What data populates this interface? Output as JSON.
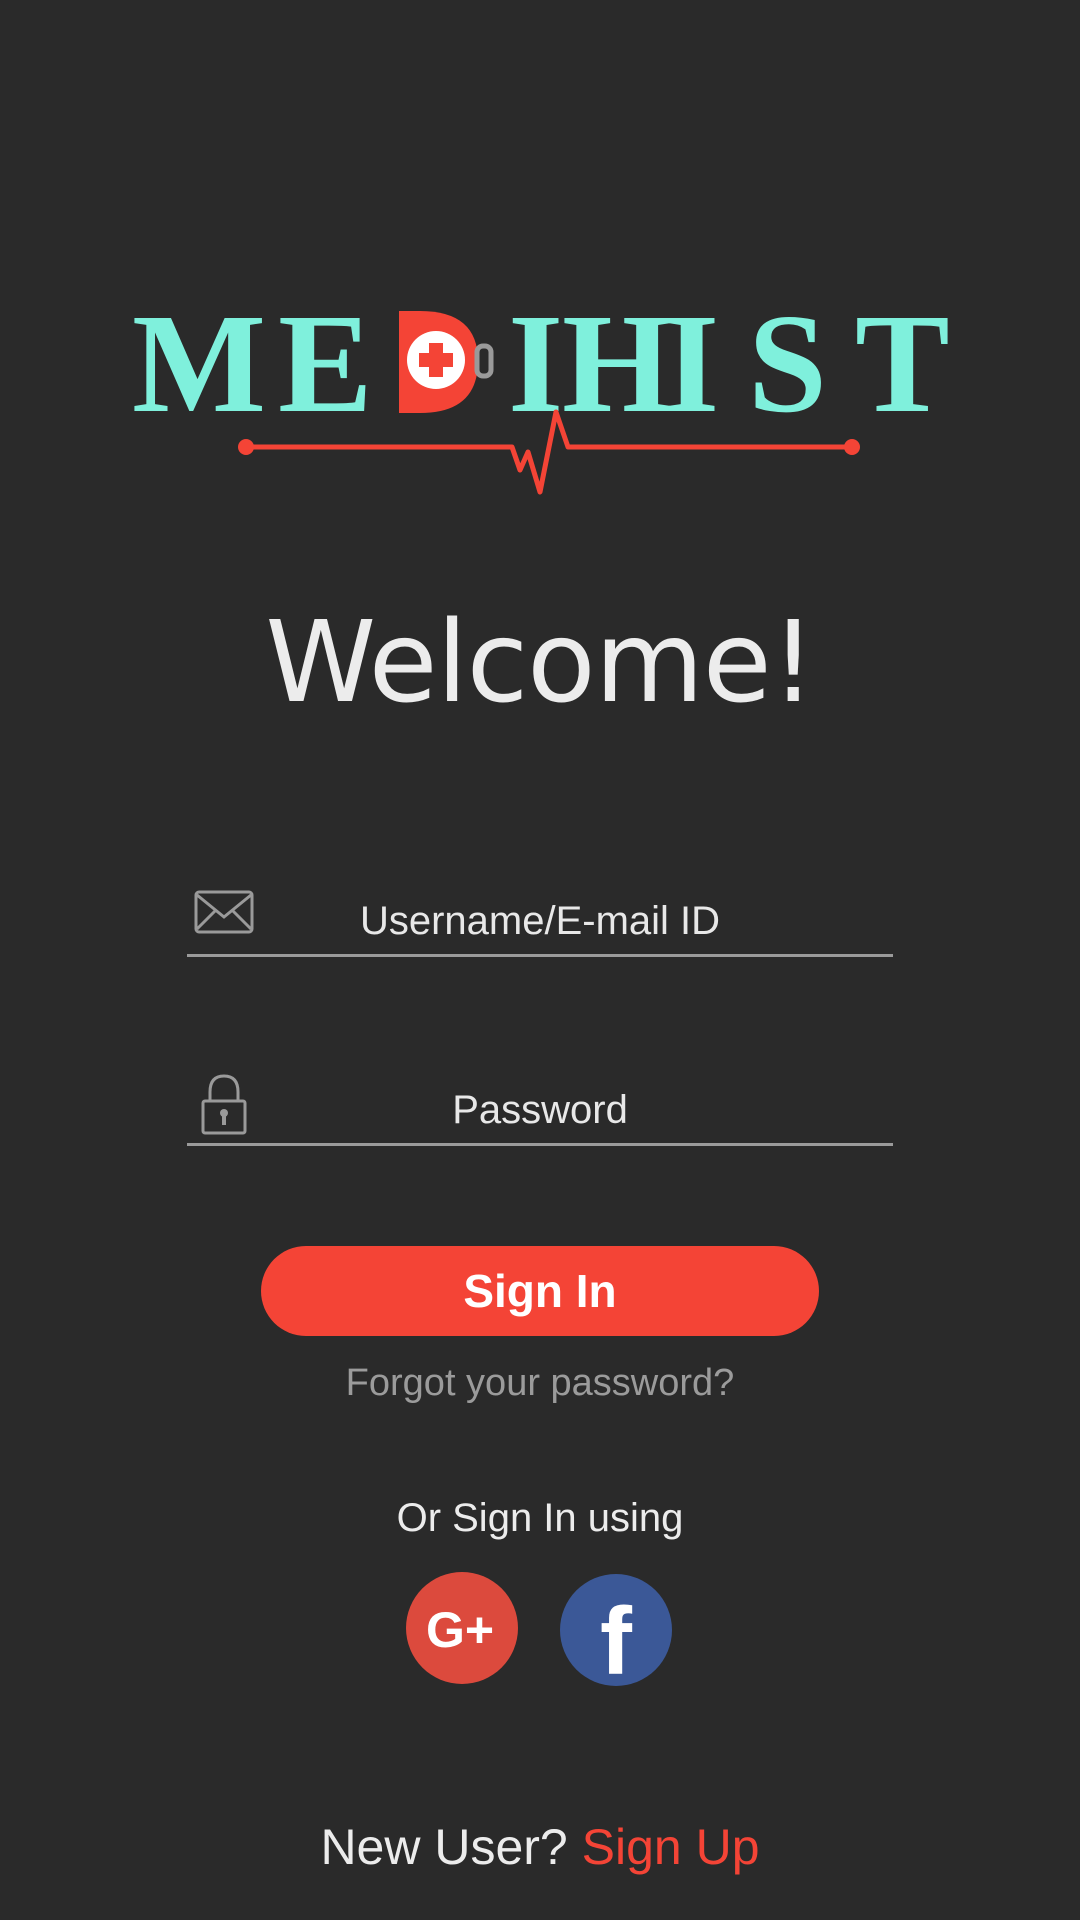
{
  "app": {
    "logo_text": "MEDIHIST",
    "colors": {
      "logo_teal": "#7ff0dc",
      "accent_red": "#f44436",
      "background": "#2a2a2a",
      "google_red": "#dc4a3d",
      "facebook_blue": "#3b5897"
    }
  },
  "welcome": "Welcome!",
  "form": {
    "username": {
      "placeholder": "Username/E-mail ID",
      "icon": "envelope-icon"
    },
    "password": {
      "placeholder": "Password",
      "icon": "lock-icon"
    },
    "signin_label": "Sign In",
    "forgot_label": "Forgot your password?"
  },
  "social": {
    "title": "Or Sign In using",
    "google_label": "G+",
    "facebook_label": "f"
  },
  "footer": {
    "new_user": "New User?",
    "signup": "Sign Up"
  }
}
